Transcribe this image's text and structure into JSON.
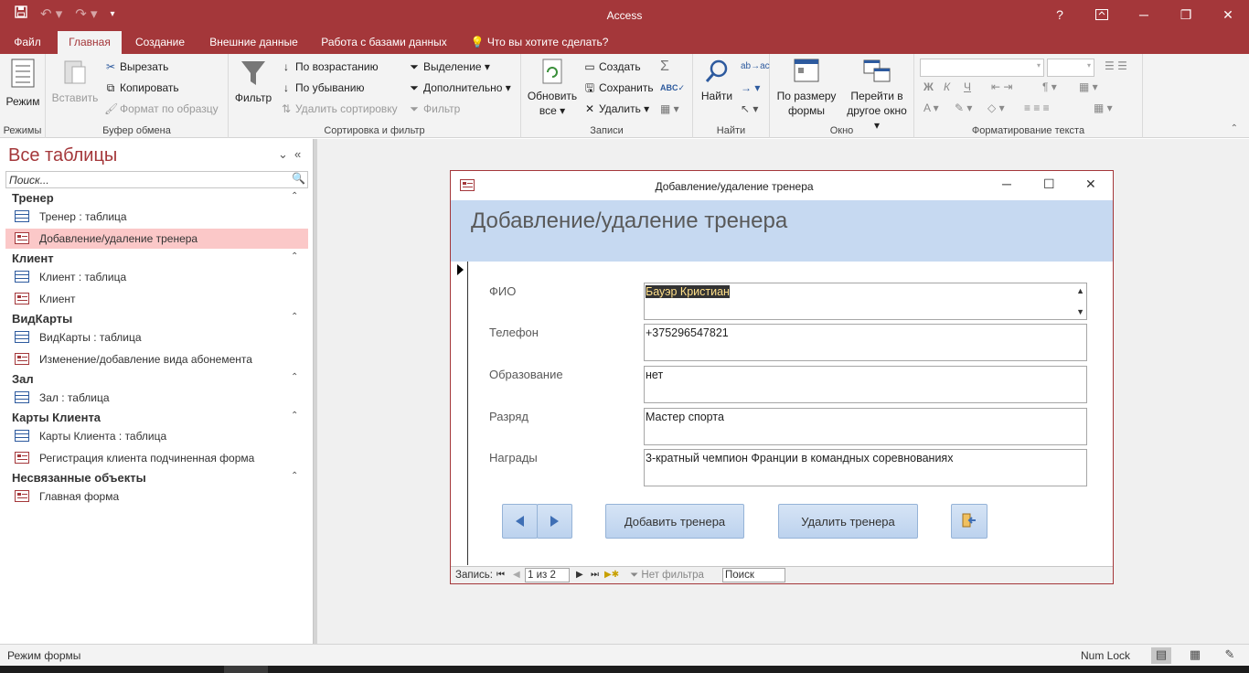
{
  "app": {
    "title": "Access"
  },
  "quick_access": {
    "save_icon": "save-icon",
    "undo_icon": "undo-icon",
    "redo_icon": "redo-icon"
  },
  "window_controls": {
    "help": "?",
    "ribbon_display": "ribbon-display-icon"
  },
  "menu": {
    "tabs": [
      {
        "label": "Файл"
      },
      {
        "label": "Главная"
      },
      {
        "label": "Создание"
      },
      {
        "label": "Внешние данные"
      },
      {
        "label": "Работа с базами данных"
      }
    ],
    "tell_me": "Что вы хотите сделать?"
  },
  "ribbon": {
    "modes": {
      "view": "Режим",
      "group": "Режимы"
    },
    "clipboard": {
      "paste": "Вставить",
      "cut": "Вырезать",
      "copy": "Копировать",
      "format_painter": "Формат по образцу",
      "group": "Буфер обмена"
    },
    "sort": {
      "filter": "Фильтр",
      "asc": "По возрастанию",
      "desc": "По убыванию",
      "remove": "Удалить сортировку",
      "selection": "Выделение",
      "advanced": "Дополнительно",
      "toggle": "Фильтр",
      "group": "Сортировка и фильтр"
    },
    "records": {
      "refresh_1": "Обновить",
      "refresh_2": "все",
      "new": "Создать",
      "save": "Сохранить",
      "delete": "Удалить",
      "group": "Записи"
    },
    "find": {
      "find": "Найти",
      "group": "Найти"
    },
    "window": {
      "fit_1": "По размеру",
      "fit_2": "формы",
      "switch_1": "Перейти в",
      "switch_2": "другое окно",
      "group": "Окно"
    },
    "text": {
      "group": "Форматирование текста",
      "bold": "Ж",
      "italic": "К",
      "underline": "Ч",
      "font_color": "A"
    }
  },
  "nav": {
    "title": "Все таблицы",
    "search_placeholder": "Поиск...",
    "groups": [
      {
        "name": "Тренер",
        "items": [
          "Тренер : таблица",
          "Добавление/удаление тренера"
        ]
      },
      {
        "name": "Клиент",
        "items": [
          "Клиент : таблица",
          "Клиент"
        ]
      },
      {
        "name": "ВидКарты",
        "items": [
          "ВидКарты : таблица",
          "Изменение/добавление вида абонемента"
        ]
      },
      {
        "name": "Зал",
        "items": [
          "Зал : таблица"
        ]
      },
      {
        "name": "Карты Клиента",
        "items": [
          "Карты Клиента : таблица",
          "Регистрация клиента подчиненная форма"
        ]
      },
      {
        "name": "Несвязанные объекты",
        "items": [
          "Главная форма"
        ]
      }
    ]
  },
  "form": {
    "window_title": "Добавление/удаление тренера",
    "header": "Добавление/удаление тренера",
    "fields": [
      {
        "label": "ФИО",
        "value": "Бауэр Кристиан"
      },
      {
        "label": "Телефон",
        "value": "+375296547821"
      },
      {
        "label": "Образование",
        "value": "нет"
      },
      {
        "label": "Разряд",
        "value": "Мастер спорта"
      },
      {
        "label": "Награды",
        "value": "3-кратный чемпион Франции в командных соревнованиях"
      }
    ],
    "buttons": {
      "add": "Добавить тренера",
      "delete": "Удалить тренера"
    },
    "record_nav": {
      "label": "Запись:",
      "position": "1 из 2",
      "filter": "Нет фильтра",
      "search": "Поиск"
    }
  },
  "status": {
    "left": "Режим формы",
    "num_lock": "Num Lock"
  }
}
